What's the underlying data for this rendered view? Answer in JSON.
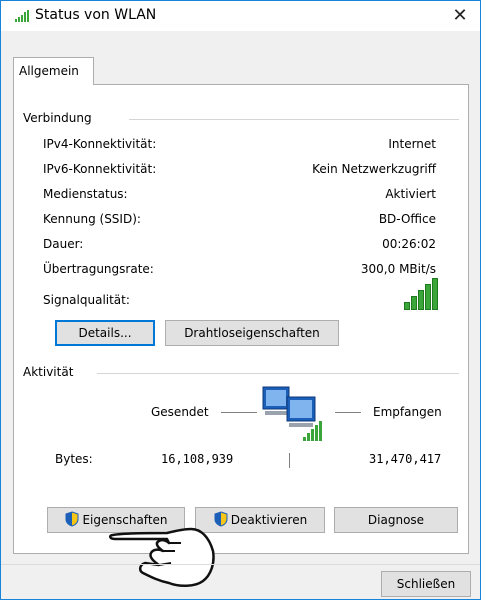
{
  "window": {
    "title": "Status von WLAN",
    "close_glyph": "✕"
  },
  "tabs": [
    {
      "label": "Allgemein"
    }
  ],
  "connection": {
    "heading": "Verbindung",
    "rows": [
      {
        "label": "IPv4-Konnektivität:",
        "value": "Internet"
      },
      {
        "label": "IPv6-Konnektivität:",
        "value": "Kein Netzwerkzugriff"
      },
      {
        "label": "Medienstatus:",
        "value": "Aktiviert"
      },
      {
        "label": "Kennung (SSID):",
        "value": "BD-Office"
      },
      {
        "label": "Dauer:",
        "value": "00:26:02"
      },
      {
        "label": "Übertragungsrate:",
        "value": "300,0 MBit/s"
      }
    ],
    "signal_label": "Signalqualität:",
    "signal_bars": 5,
    "details_button": "Details...",
    "wireless_props_button": "Drahtloseigenschaften"
  },
  "activity": {
    "heading": "Aktivität",
    "sent_label": "Gesendet",
    "received_label": "Empfangen",
    "bytes_label": "Bytes:",
    "bytes_sent": "16,108,939",
    "bytes_received": "31,470,417"
  },
  "actions": {
    "properties_button": "Eigenschaften",
    "disable_button": "Deaktivieren",
    "diagnose_button": "Diagnose"
  },
  "footer": {
    "close_button": "Schließen"
  },
  "colors": {
    "accent": "#0078d7",
    "signal": "#3aa63a",
    "window_border": "#1883d7"
  }
}
